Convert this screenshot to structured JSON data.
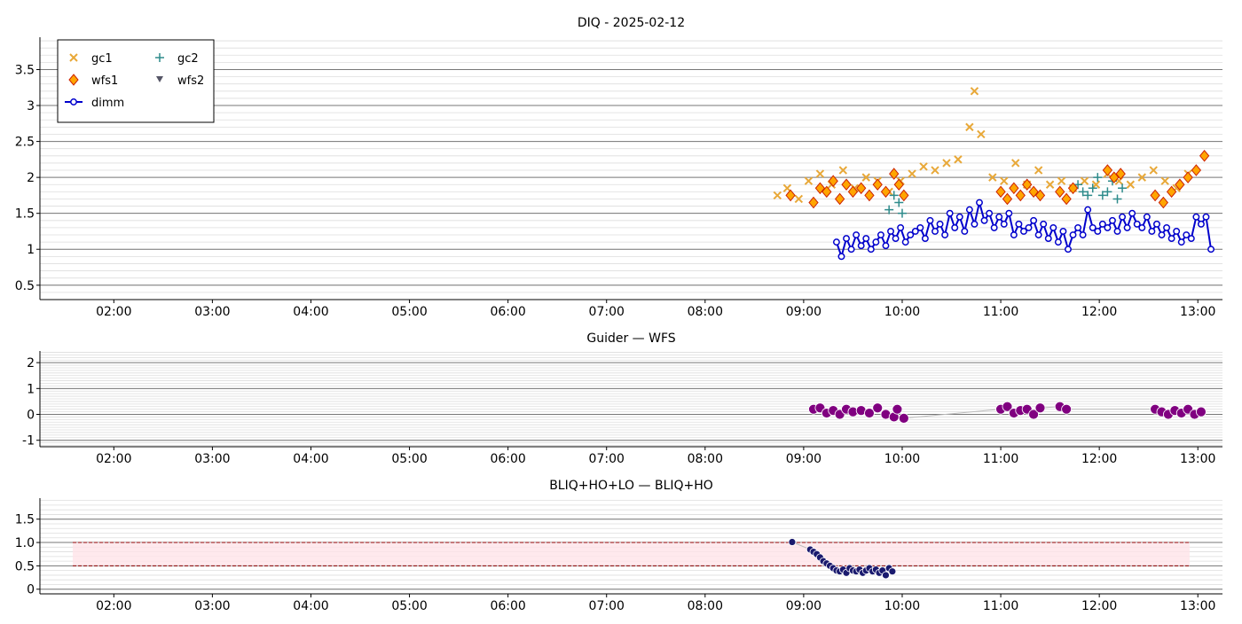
{
  "chart_data": [
    {
      "type": "scatter",
      "title": "DIQ - 2025-02-12",
      "x_ticks": [
        "02:00",
        "03:00",
        "04:00",
        "05:00",
        "06:00",
        "07:00",
        "08:00",
        "09:00",
        "10:00",
        "11:00",
        "12:00",
        "13:00"
      ],
      "xlim": [
        "01:15",
        "13:15"
      ],
      "ylim": [
        0.3,
        3.95
      ],
      "y_ticks": [
        "0.5",
        "1",
        "1.5",
        "2",
        "2.5",
        "3",
        "3.5"
      ],
      "grid": true,
      "legend": {
        "placement": "top-left",
        "entries": [
          {
            "name": "gc1",
            "marker": "x",
            "color": "#e8a838"
          },
          {
            "name": "gc2",
            "marker": "+",
            "color": "#2e8b8b"
          },
          {
            "name": "wfs1",
            "marker": "diamond",
            "color": "#ffa500"
          },
          {
            "name": "wfs2",
            "marker": "triangle-down",
            "color": "#555566"
          },
          {
            "name": "dimm",
            "marker": "circle-line",
            "color": "#0000cc"
          }
        ]
      },
      "series": [
        {
          "name": "gc1",
          "x": [
            "08:44",
            "08:50",
            "08:57",
            "09:03",
            "09:10",
            "09:17",
            "09:24",
            "09:31",
            "09:38",
            "09:45",
            "09:52",
            "09:59",
            "10:06",
            "10:13",
            "10:20",
            "10:27",
            "10:34",
            "10:41",
            "10:44",
            "10:48",
            "10:55",
            "11:02",
            "11:09",
            "11:16",
            "11:23",
            "11:30",
            "11:37",
            "11:44",
            "11:51",
            "11:58",
            "12:05",
            "12:12",
            "12:19",
            "12:26",
            "12:33",
            "12:40",
            "12:47",
            "12:54"
          ],
          "y": [
            1.75,
            1.85,
            1.7,
            1.95,
            2.05,
            1.9,
            2.1,
            1.85,
            2.0,
            1.95,
            1.8,
            1.95,
            2.05,
            2.15,
            2.1,
            2.2,
            2.25,
            2.7,
            3.2,
            2.6,
            2.0,
            1.95,
            2.2,
            1.9,
            2.1,
            1.9,
            1.95,
            1.85,
            1.95,
            1.9,
            2.05,
            1.95,
            1.9,
            2.0,
            2.1,
            1.95,
            1.85,
            2.05
          ]
        },
        {
          "name": "gc2",
          "x": [
            "09:52",
            "09:55",
            "09:58",
            "10:00",
            "11:47",
            "11:50",
            "11:53",
            "11:56",
            "11:59",
            "12:02",
            "12:05",
            "12:08",
            "12:11",
            "12:14"
          ],
          "y": [
            1.55,
            1.75,
            1.65,
            1.5,
            1.9,
            1.8,
            1.75,
            1.85,
            2.0,
            1.75,
            1.8,
            1.95,
            1.7,
            1.85
          ]
        },
        {
          "name": "wfs1",
          "x": [
            "08:52",
            "09:06",
            "09:10",
            "09:14",
            "09:18",
            "09:22",
            "09:26",
            "09:30",
            "09:35",
            "09:40",
            "09:45",
            "09:50",
            "09:55",
            "09:58",
            "10:01",
            "11:00",
            "11:04",
            "11:08",
            "11:12",
            "11:16",
            "11:20",
            "11:24",
            "11:36",
            "11:40",
            "11:44",
            "12:05",
            "12:09",
            "12:13",
            "12:34",
            "12:39",
            "12:44",
            "12:49",
            "12:54",
            "12:59",
            "13:04"
          ],
          "y": [
            1.75,
            1.65,
            1.85,
            1.8,
            1.95,
            1.7,
            1.9,
            1.8,
            1.85,
            1.75,
            1.9,
            1.8,
            2.05,
            1.9,
            1.75,
            1.8,
            1.7,
            1.85,
            1.75,
            1.9,
            1.8,
            1.75,
            1.8,
            1.7,
            1.85,
            2.1,
            2.0,
            2.05,
            1.75,
            1.65,
            1.8,
            1.9,
            2.0,
            2.1,
            2.3
          ]
        },
        {
          "name": "wfs2",
          "x": [],
          "y": []
        },
        {
          "name": "dimm",
          "x": [
            "09:20",
            "09:23",
            "09:26",
            "09:29",
            "09:32",
            "09:35",
            "09:38",
            "09:41",
            "09:44",
            "09:47",
            "09:50",
            "09:53",
            "09:56",
            "09:59",
            "10:02",
            "10:05",
            "10:08",
            "10:11",
            "10:14",
            "10:17",
            "10:20",
            "10:23",
            "10:26",
            "10:29",
            "10:32",
            "10:35",
            "10:38",
            "10:41",
            "10:44",
            "10:47",
            "10:50",
            "10:53",
            "10:56",
            "10:59",
            "11:02",
            "11:05",
            "11:08",
            "11:11",
            "11:14",
            "11:17",
            "11:20",
            "11:23",
            "11:26",
            "11:29",
            "11:32",
            "11:35",
            "11:38",
            "11:41",
            "11:44",
            "11:47",
            "11:50",
            "11:53",
            "11:56",
            "11:59",
            "12:02",
            "12:05",
            "12:08",
            "12:11",
            "12:14",
            "12:17",
            "12:20",
            "12:23",
            "12:26",
            "12:29",
            "12:32",
            "12:35",
            "12:38",
            "12:41",
            "12:44",
            "12:47",
            "12:50",
            "12:53",
            "12:56",
            "12:59",
            "13:02",
            "13:05",
            "13:08"
          ],
          "y": [
            1.1,
            0.9,
            1.15,
            1.0,
            1.2,
            1.05,
            1.15,
            1.0,
            1.1,
            1.2,
            1.05,
            1.25,
            1.15,
            1.3,
            1.1,
            1.2,
            1.25,
            1.3,
            1.15,
            1.4,
            1.25,
            1.35,
            1.2,
            1.5,
            1.3,
            1.45,
            1.25,
            1.55,
            1.35,
            1.65,
            1.4,
            1.5,
            1.3,
            1.45,
            1.35,
            1.5,
            1.2,
            1.35,
            1.25,
            1.3,
            1.4,
            1.2,
            1.35,
            1.15,
            1.3,
            1.1,
            1.25,
            1.0,
            1.2,
            1.3,
            1.2,
            1.55,
            1.3,
            1.25,
            1.35,
            1.3,
            1.4,
            1.25,
            1.45,
            1.3,
            1.5,
            1.35,
            1.3,
            1.45,
            1.25,
            1.35,
            1.2,
            1.3,
            1.15,
            1.25,
            1.1,
            1.2,
            1.15,
            1.45,
            1.35,
            1.45,
            1.0
          ]
        }
      ]
    },
    {
      "type": "scatter",
      "title": "Guider — WFS",
      "x_ticks": [
        "02:00",
        "03:00",
        "04:00",
        "05:00",
        "06:00",
        "07:00",
        "08:00",
        "09:00",
        "10:00",
        "11:00",
        "12:00",
        "13:00"
      ],
      "xlim": [
        "01:15",
        "13:15"
      ],
      "ylim": [
        -1.25,
        2.45
      ],
      "y_ticks": [
        "-1",
        "0",
        "1",
        "2"
      ],
      "grid": true,
      "series": [
        {
          "name": "",
          "color": "#800080",
          "x": [
            "09:06",
            "09:10",
            "09:14",
            "09:18",
            "09:22",
            "09:26",
            "09:30",
            "09:35",
            "09:40",
            "09:45",
            "09:50",
            "09:55",
            "09:57",
            "10:01",
            "11:00",
            "11:04",
            "11:08",
            "11:12",
            "11:16",
            "11:20",
            "11:24",
            "11:36",
            "11:40",
            "12:34",
            "12:38",
            "12:42",
            "12:46",
            "12:50",
            "12:54",
            "12:58",
            "13:02"
          ],
          "y": [
            0.2,
            0.25,
            0.05,
            0.15,
            0.0,
            0.2,
            0.1,
            0.15,
            0.05,
            0.25,
            0.0,
            -0.1,
            0.2,
            -0.15,
            0.2,
            0.3,
            0.05,
            0.15,
            0.2,
            0.0,
            0.25,
            0.3,
            0.2,
            0.2,
            0.1,
            0.0,
            0.15,
            0.05,
            0.2,
            0.0,
            0.1
          ]
        }
      ]
    },
    {
      "type": "scatter",
      "title": "BLIQ+HO+LO — BLIQ+HO",
      "x_ticks": [
        "02:00",
        "03:00",
        "04:00",
        "05:00",
        "06:00",
        "07:00",
        "08:00",
        "09:00",
        "10:00",
        "11:00",
        "12:00",
        "13:00"
      ],
      "xlim": [
        "01:15",
        "13:15"
      ],
      "ylim": [
        -0.1,
        1.95
      ],
      "y_ticks": [
        "0",
        "0.5",
        "1.0",
        "1.5"
      ],
      "grid": true,
      "band": {
        "from_x": "01:35",
        "to_x": "12:55",
        "y_low": 0.5,
        "y_high": 1.0,
        "color": "#ffe4e8",
        "line_color": "#8b0000"
      },
      "series": [
        {
          "name": "",
          "color": "#1a1a6e",
          "x": [
            "08:53",
            "09:04",
            "09:06",
            "09:08",
            "09:10",
            "09:12",
            "09:14",
            "09:16",
            "09:18",
            "09:20",
            "09:22",
            "09:24",
            "09:26",
            "09:28",
            "09:30",
            "09:32",
            "09:34",
            "09:36",
            "09:38",
            "09:40",
            "09:42",
            "09:44",
            "09:46",
            "09:48",
            "09:50",
            "09:52",
            "09:54"
          ],
          "y": [
            1.01,
            0.85,
            0.8,
            0.75,
            0.68,
            0.6,
            0.55,
            0.5,
            0.45,
            0.4,
            0.38,
            0.42,
            0.35,
            0.45,
            0.4,
            0.38,
            0.42,
            0.35,
            0.4,
            0.45,
            0.38,
            0.42,
            0.35,
            0.4,
            0.3,
            0.45,
            0.38
          ]
        }
      ]
    }
  ]
}
